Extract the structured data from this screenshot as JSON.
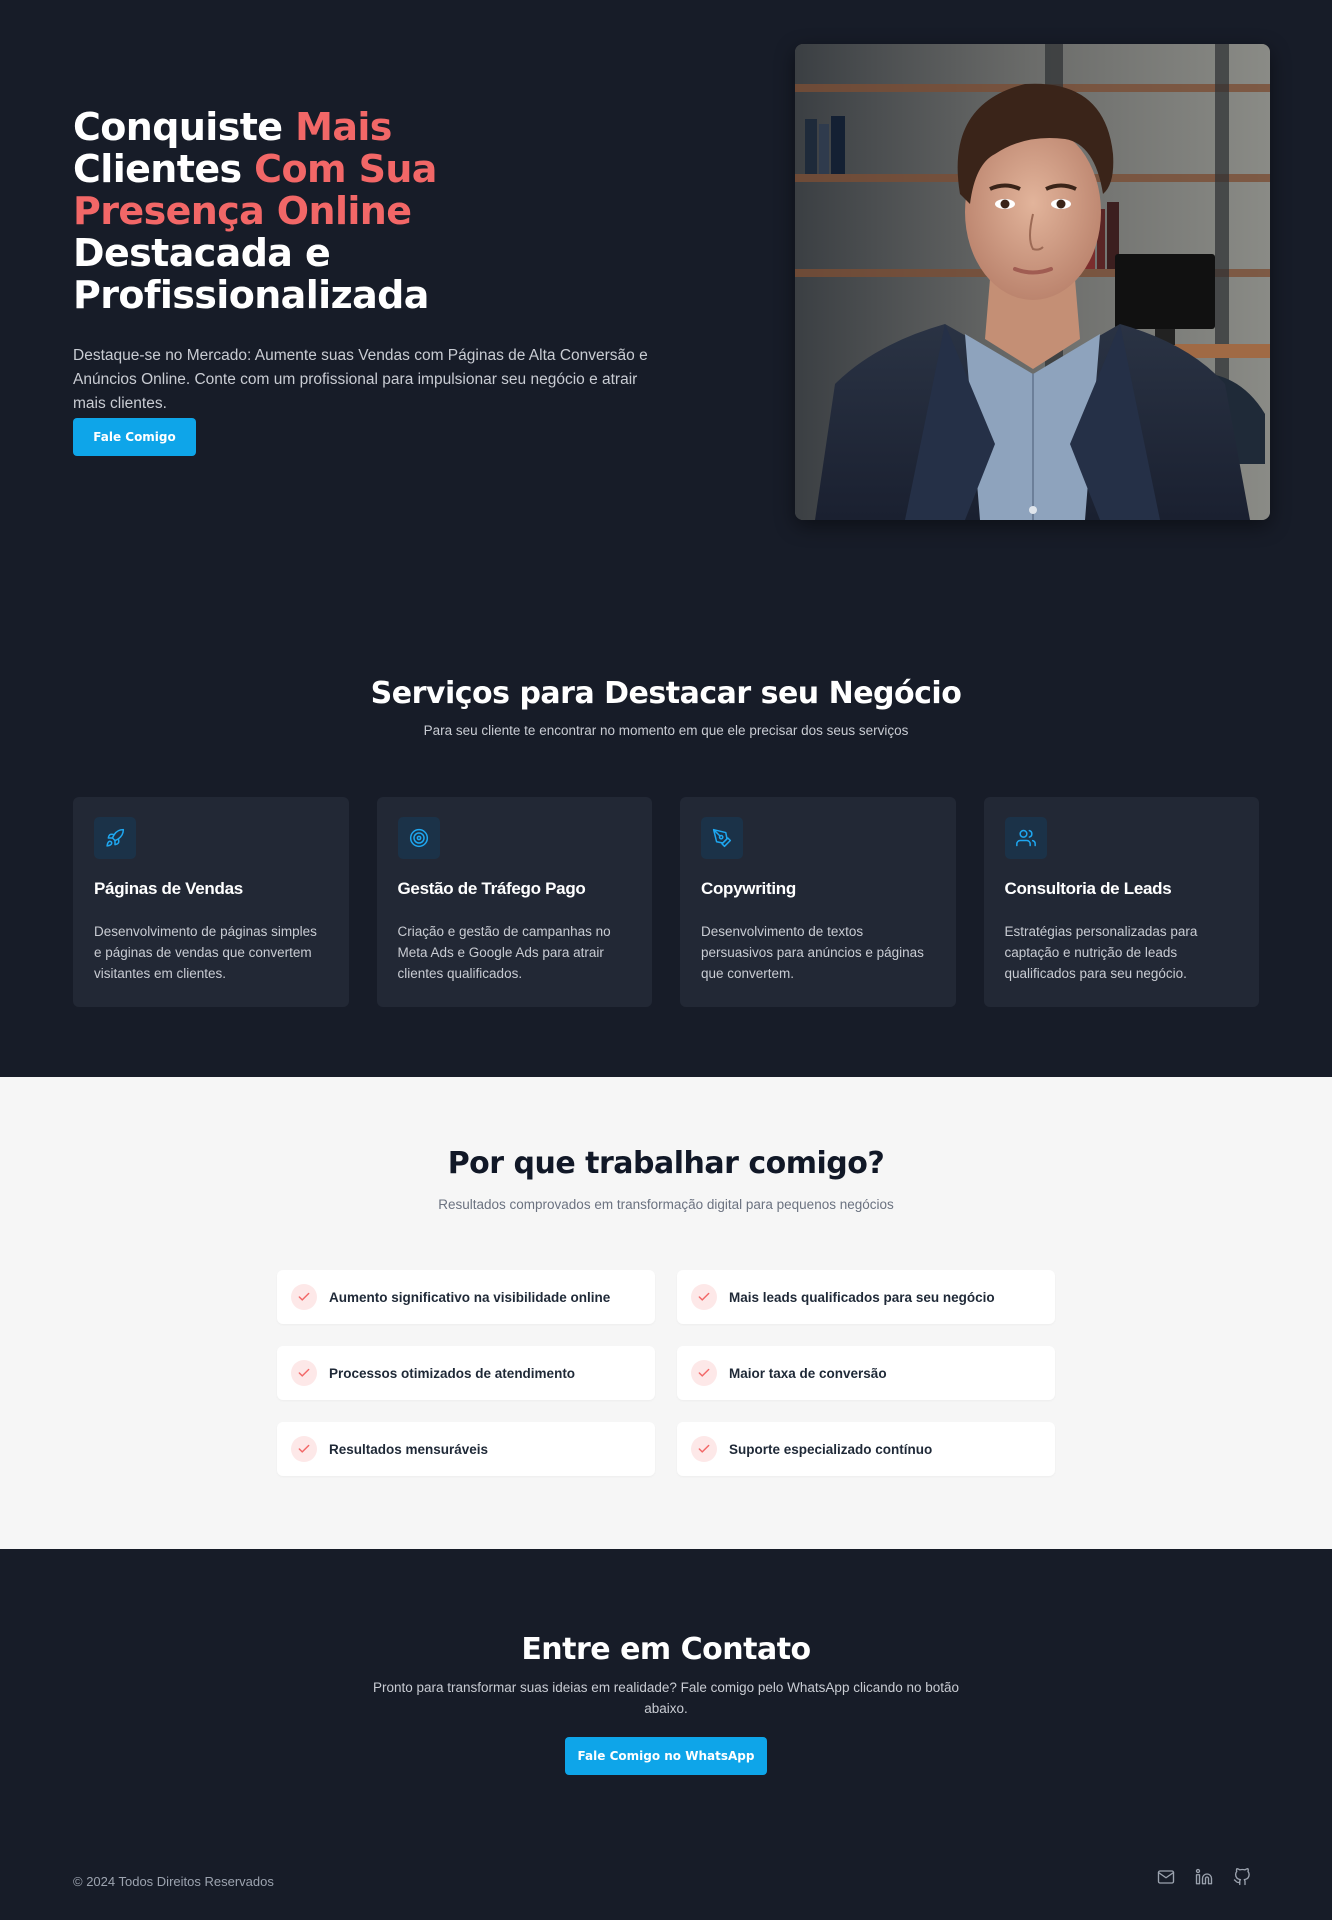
{
  "hero": {
    "title": {
      "part1": "Conquiste ",
      "part2": "Mais",
      "part3": "Clientes ",
      "part4": "Com Sua",
      "part5": "Presença Online",
      "part6": "Destacada e Profissionalizada"
    },
    "description": "Destaque-se no Mercado: Aumente suas Vendas com Páginas de Alta Conversão e Anúncios Online. Conte com um profissional para impulsionar seu negócio e atrair mais clientes.",
    "cta_label": "Fale Comigo",
    "accent_color": "#f26767",
    "button_color": "#0ea5e9"
  },
  "services": {
    "title": "Serviços para Destacar seu Negócio",
    "subtitle": "Para seu cliente te encontrar no momento em que ele precisar dos seus serviços",
    "items": [
      {
        "icon": "rocket-icon",
        "title": "Páginas de Vendas",
        "description": "Desenvolvimento de páginas simples e páginas de vendas que convertem visitantes em clientes."
      },
      {
        "icon": "target-icon",
        "title": "Gestão de Tráfego Pago",
        "description": "Criação e gestão de campanhas no Meta Ads e Google Ads para atrair clientes qualificados."
      },
      {
        "icon": "pen-tool-icon",
        "title": "Copywriting",
        "description": "Desenvolvimento de textos persuasivos para anúncios e páginas que convertem."
      },
      {
        "icon": "users-icon",
        "title": "Consultoria de Leads",
        "description": "Estratégias personalizadas para captação e nutrição de leads qualificados para seu negócio."
      }
    ]
  },
  "why": {
    "title": "Por que trabalhar comigo?",
    "subtitle": "Resultados comprovados em transformação digital para pequenos negócios",
    "benefits": [
      "Aumento significativo na visibilidade online",
      "Mais leads qualificados para seu negócio",
      "Processos otimizados de atendimento",
      "Maior taxa de conversão",
      "Resultados mensuráveis",
      "Suporte especializado contínuo"
    ]
  },
  "contact": {
    "title": "Entre em Contato",
    "description": "Pronto para transformar suas ideias em realidade? Fale comigo pelo WhatsApp clicando no botão abaixo.",
    "cta_label": "Fale Comigo no WhatsApp"
  },
  "footer": {
    "copyright": "© 2024 Todos Direitos Reservados",
    "social": [
      "mail-icon",
      "linkedin-icon",
      "github-icon"
    ]
  }
}
